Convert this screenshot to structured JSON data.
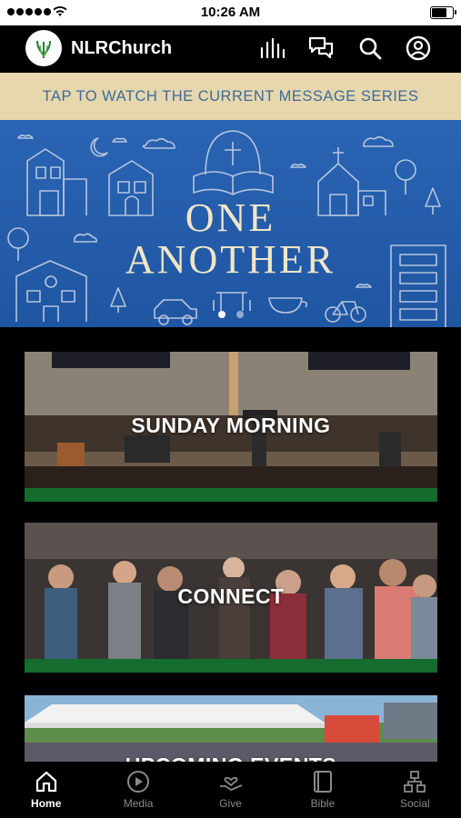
{
  "status": {
    "time": "10:26 AM",
    "battery_level": 0.85
  },
  "header": {
    "app_name": "NLRChurch",
    "icons": [
      "equalizer-icon",
      "chat-icon",
      "search-icon",
      "profile-icon"
    ]
  },
  "banner": {
    "caption": "TAP TO WATCH THE CURRENT MESSAGE SERIES",
    "series_title_line1": "ONE",
    "series_title_line2": "ANOTHER",
    "page_count": 2,
    "active_page": 1
  },
  "cards": [
    {
      "label": "SUNDAY MORNING"
    },
    {
      "label": "CONNECT"
    },
    {
      "label": "UPCOMING EVENTS"
    }
  ],
  "tabs": [
    {
      "label": "Home",
      "icon": "home-icon",
      "active": true
    },
    {
      "label": "Media",
      "icon": "play-icon",
      "active": false
    },
    {
      "label": "Give",
      "icon": "give-hand-heart-icon",
      "active": false
    },
    {
      "label": "Bible",
      "icon": "book-icon",
      "active": false
    },
    {
      "label": "Social",
      "icon": "social-network-icon",
      "active": false
    }
  ],
  "colors": {
    "banner_gold": "#e6d7ad",
    "banner_text": "#3d6b9a",
    "series_blue": "#2a64b3",
    "card_accent": "#146c2e"
  }
}
